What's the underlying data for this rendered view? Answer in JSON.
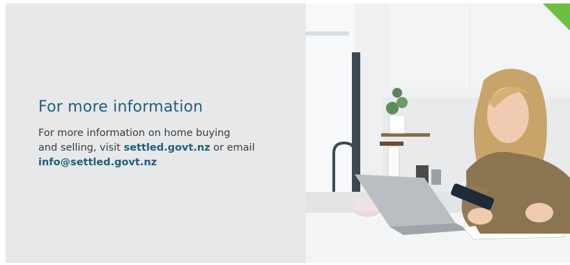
{
  "info": {
    "heading": "For more information",
    "intro_line1": "For more information on home buying",
    "intro_line2_prefix": "and selling, visit ",
    "website_link": "settled.govt.nz",
    "connector": " or email",
    "email_link": "info@settled.govt.nz"
  },
  "photo": {
    "subject": "woman-using-phone-at-kitchen-counter-with-laptop"
  },
  "colors": {
    "panel_background": "#e6e8ea",
    "heading_text": "#1f5f7a",
    "body_text": "#3a3a3a",
    "corner_accent": "#6cbf3f"
  }
}
